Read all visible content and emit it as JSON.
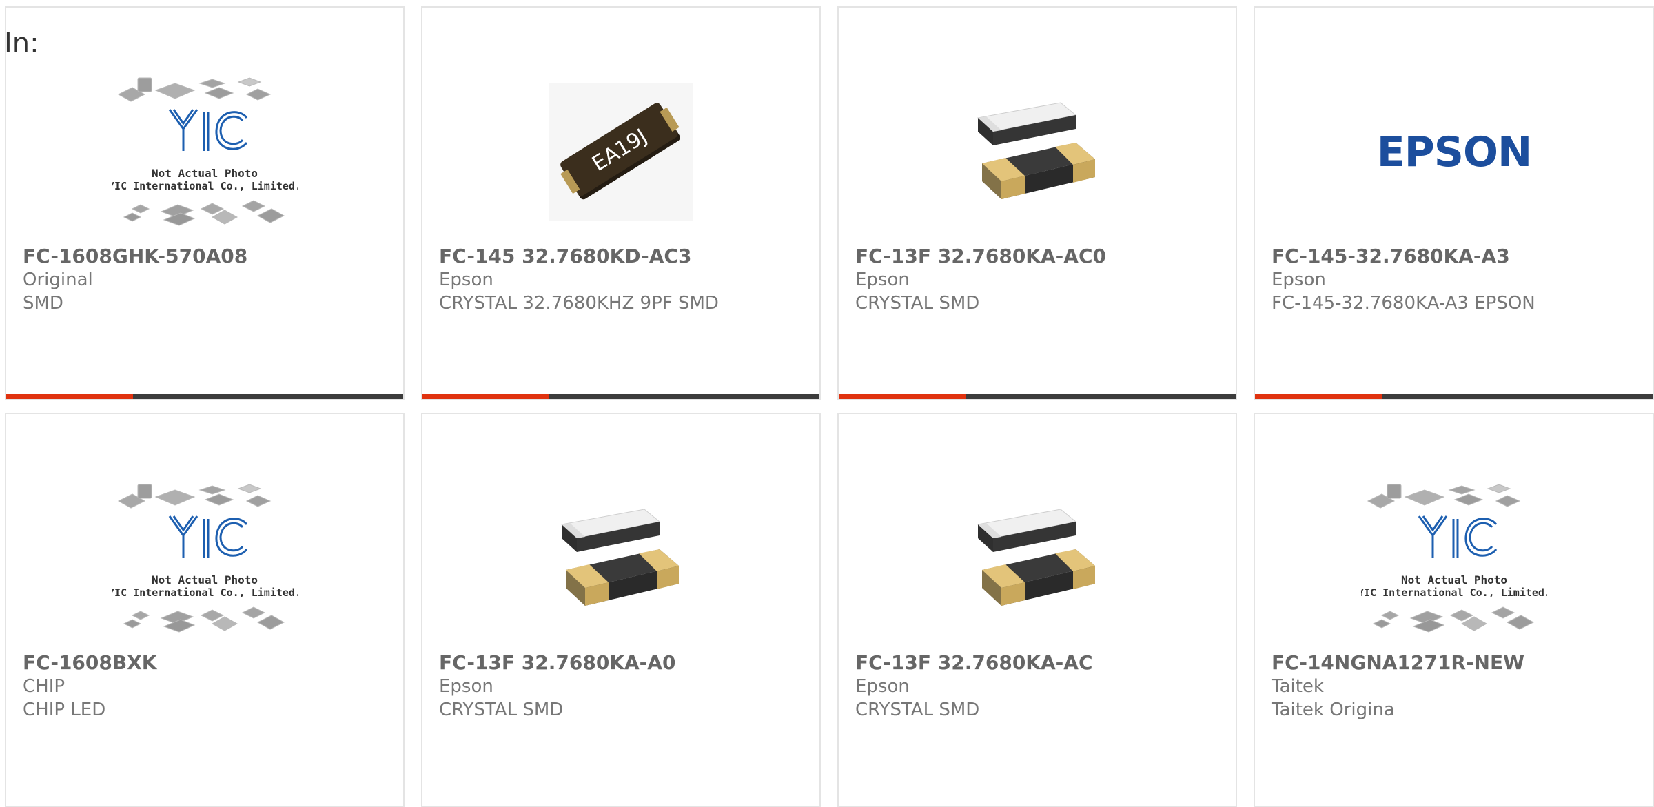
{
  "page": {
    "label": "In:"
  },
  "colors": {
    "card_border": "#e4e4e4",
    "part_number_text": "#666666",
    "secondary_text": "#777777",
    "accent_bar": "#e0320f",
    "bar_track": "#3c3c3c",
    "yic_logo_blue": "#1d5fb0",
    "epson_blue": "#1c4e9d"
  },
  "products": [
    {
      "image": "yic-not-actual-photo",
      "photo_caption_1": "Not Actual Photo",
      "photo_caption_2": "YIC International Co., Limited.",
      "logo_text": "YIC",
      "part_number": "FC-1608GHK-570A08",
      "manufacturer": "Original",
      "description": "SMD",
      "progress": 0.32
    },
    {
      "image": "crystal-ea19j",
      "chip_marking": "EA19J",
      "part_number": "FC-145 32.7680KD-AC3",
      "manufacturer": "Epson",
      "description": "CRYSTAL 32.7680KHZ 9PF SMD",
      "progress": 0.32
    },
    {
      "image": "crystal-smd-pair",
      "part_number": "FC-13F 32.7680KA-AC0",
      "manufacturer": "Epson",
      "description": "CRYSTAL SMD",
      "progress": 0.32
    },
    {
      "image": "epson-logo",
      "logo_text": "EPSON",
      "part_number": "FC-145-32.7680KA-A3",
      "manufacturer": "Epson",
      "description": "FC-145-32.7680KA-A3 EPSON",
      "progress": 0.32
    },
    {
      "image": "yic-not-actual-photo",
      "photo_caption_1": "Not Actual Photo",
      "photo_caption_2": "YIC International Co., Limited.",
      "logo_text": "YIC",
      "part_number": "FC-1608BXK",
      "manufacturer": "CHIP",
      "description": "CHIP LED"
    },
    {
      "image": "crystal-smd-pair",
      "part_number": "FC-13F 32.7680KA-A0",
      "manufacturer": "Epson",
      "description": "CRYSTAL SMD"
    },
    {
      "image": "crystal-smd-pair",
      "part_number": "FC-13F 32.7680KA-AC",
      "manufacturer": "Epson",
      "description": "CRYSTAL SMD"
    },
    {
      "image": "yic-not-actual-photo",
      "photo_caption_1": "Not Actual Photo",
      "photo_caption_2": "YIC International Co., Limited.",
      "logo_text": "YIC",
      "part_number": "FC-14NGNA1271R-NEW",
      "manufacturer": "Taitek",
      "description": "Taitek Origina"
    }
  ]
}
